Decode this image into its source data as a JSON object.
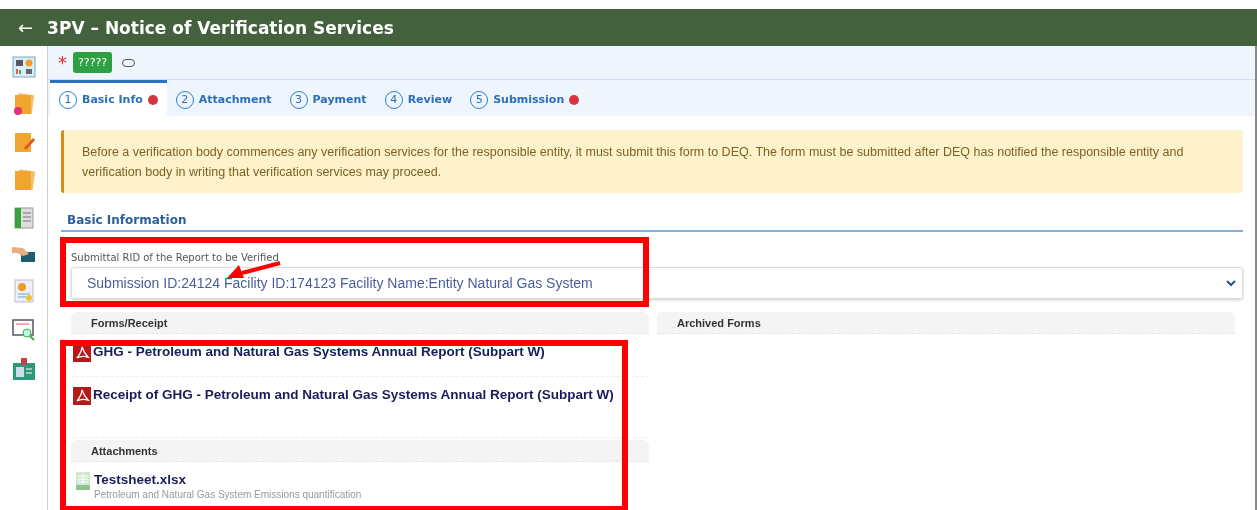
{
  "header": {
    "back": "←",
    "title": "3PV – Notice of Verification Services"
  },
  "toolbar": {
    "required_mark": "*",
    "status_badge": "?????"
  },
  "tabs": [
    {
      "number": "1",
      "label": "Basic Info",
      "selected": true,
      "error": true
    },
    {
      "number": "2",
      "label": "Attachment",
      "selected": false,
      "error": false
    },
    {
      "number": "3",
      "label": "Payment",
      "selected": false,
      "error": false
    },
    {
      "number": "4",
      "label": "Review",
      "selected": false,
      "error": false
    },
    {
      "number": "5",
      "label": "Submission",
      "selected": false,
      "error": true
    }
  ],
  "notice": "Before a verification body commences any verification services for the responsible entity, it must submit this form to DEQ. The form must be submitted after DEQ has notified the responsible entity and verification body in writing that verification services may proceed.",
  "section_title": "Basic Information",
  "rid_field": {
    "label": "Submittal RID of the Report to be Verified",
    "value": "Submission ID:24124 Facility ID:174123 Facility Name:Entity Natural Gas System"
  },
  "forms": {
    "title": "Forms/Receipt",
    "items": [
      {
        "kind": "pdf",
        "name": "GHG - Petroleum and Natural Gas Systems Annual Report (Subpart W)"
      },
      {
        "kind": "pdf",
        "name": "Receipt of GHG - Petroleum and Natural Gas Systems Annual Report (Subpart W)"
      }
    ]
  },
  "attachments": {
    "title": "Attachments",
    "items": [
      {
        "kind": "xlsx",
        "name": "Testsheet.xlsx",
        "description": "Petroleum and Natural Gas System Emissions quantification"
      }
    ]
  },
  "archived": {
    "title": "Archived Forms"
  }
}
